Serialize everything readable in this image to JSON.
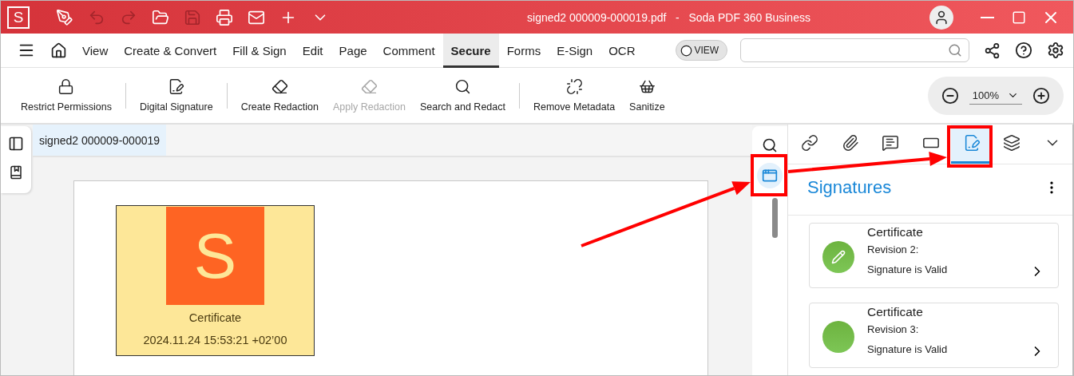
{
  "title_bar": {
    "logo": "S",
    "title": "signed2 000009-000019.pdf   -   Soda PDF 360 Business",
    "quick_tools": [
      {
        "kind": "pen",
        "disabled": false
      },
      {
        "kind": "undo",
        "disabled": true
      },
      {
        "kind": "redo",
        "disabled": true
      },
      {
        "kind": "open",
        "disabled": false
      },
      {
        "kind": "save",
        "disabled": true
      },
      {
        "kind": "print",
        "disabled": false
      },
      {
        "kind": "mail",
        "disabled": false
      },
      {
        "kind": "plus",
        "disabled": false
      },
      {
        "kind": "more",
        "disabled": false
      }
    ]
  },
  "menu": {
    "items": [
      {
        "label": "View",
        "selected": false
      },
      {
        "label": "Create & Convert",
        "selected": false
      },
      {
        "label": "Fill & Sign",
        "selected": false
      },
      {
        "label": "Edit",
        "selected": false
      },
      {
        "label": "Page",
        "selected": false
      },
      {
        "label": "Comment",
        "selected": false
      },
      {
        "label": "Secure",
        "selected": true
      },
      {
        "label": "Forms",
        "selected": false
      },
      {
        "label": "E-Sign",
        "selected": false
      },
      {
        "label": "OCR",
        "selected": false
      }
    ],
    "view_toggle": {
      "label": "VIEW",
      "on": false
    }
  },
  "toolbar": {
    "groups": [
      [
        {
          "kind": "lock",
          "label": "Restrict Permissions",
          "disabled": false
        }
      ],
      [
        {
          "kind": "signature",
          "label": "Digital Signature",
          "disabled": false
        }
      ],
      [
        {
          "kind": "redact",
          "label": "Create Redaction",
          "disabled": false
        },
        {
          "kind": "apply",
          "label": "Apply Redaction",
          "disabled": true
        },
        {
          "kind": "search",
          "label": "Search and Redact",
          "disabled": false
        }
      ],
      [
        {
          "kind": "metadata",
          "label": "Remove Metadata",
          "disabled": false
        },
        {
          "kind": "sanitize",
          "label": "Sanitize",
          "disabled": false
        }
      ]
    ],
    "zoom": "100%"
  },
  "document": {
    "tab": "signed2 000009-000019",
    "stamp": {
      "logo": "S",
      "label": "Certificate",
      "date": "2024.11.24 15:53:21 +02’00"
    }
  },
  "side_strip": [
    {
      "kind": "search",
      "selected": false
    },
    {
      "kind": "panel",
      "selected": true
    }
  ],
  "panel": {
    "tabs": [
      {
        "kind": "link",
        "selected": false
      },
      {
        "kind": "attachment",
        "selected": false
      },
      {
        "kind": "comment",
        "selected": false
      },
      {
        "kind": "field",
        "selected": false
      },
      {
        "kind": "signature",
        "selected": true
      },
      {
        "kind": "layers",
        "selected": false
      },
      {
        "kind": "more",
        "selected": false
      }
    ],
    "title": "Signatures",
    "signatures": [
      {
        "kind": "edit",
        "title": "Certificate",
        "revision": "Revision 2:",
        "status": "Signature is Valid"
      },
      {
        "kind": "plain",
        "title": "Certificate",
        "revision": "Revision 3:",
        "status": "Signature is Valid"
      }
    ]
  }
}
